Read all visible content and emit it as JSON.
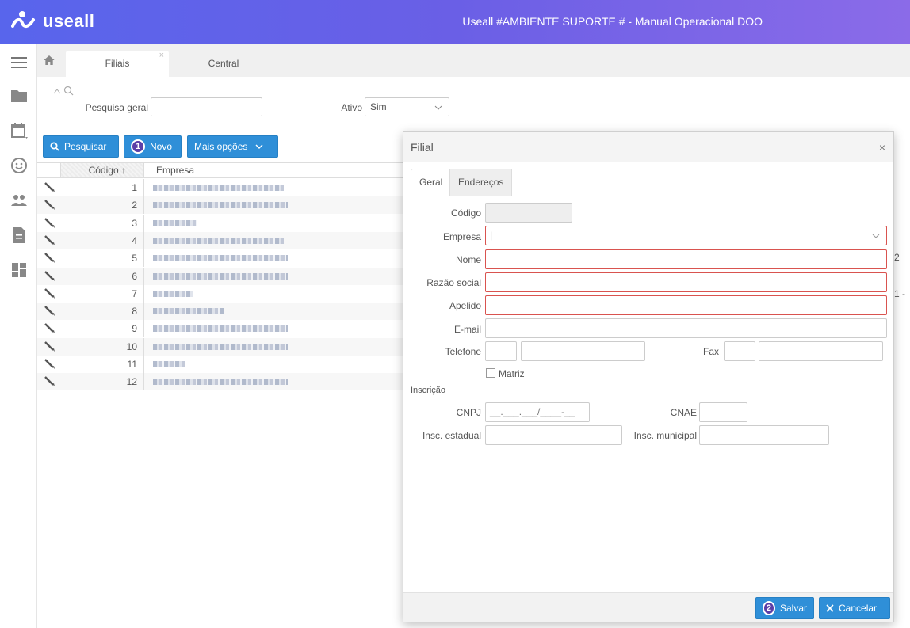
{
  "header": {
    "logo_text": "useall",
    "title": "Useall #AMBIENTE SUPORTE # - Manual Operacional DOO"
  },
  "sidebar": {
    "items": [
      "menu-icon",
      "folder-icon",
      "calendar-icon",
      "face-icon",
      "people-icon",
      "document-icon",
      "dashboard-icon"
    ]
  },
  "tabs": [
    {
      "label": "Filiais",
      "close": "×"
    },
    {
      "label": "Central"
    }
  ],
  "search": {
    "toggle": "^",
    "general_label": "Pesquisa geral",
    "general_value": "",
    "active_label": "Ativo",
    "active_value": "Sim"
  },
  "toolbar": {
    "search_label": "Pesquisar",
    "new_badge": "1",
    "new_label": "Novo",
    "more_label": "Mais opções"
  },
  "grid": {
    "col_code": "Código ↑",
    "col_company": "Empresa",
    "rows": [
      {
        "code": "1"
      },
      {
        "code": "2"
      },
      {
        "code": "3"
      },
      {
        "code": "4"
      },
      {
        "code": "5"
      },
      {
        "code": "6"
      },
      {
        "code": "7"
      },
      {
        "code": "8"
      },
      {
        "code": "9"
      },
      {
        "code": "10"
      },
      {
        "code": "11"
      },
      {
        "code": "12"
      }
    ]
  },
  "peek": {
    "row5": "2",
    "row7": "1 -"
  },
  "modal": {
    "title": "Filial",
    "close": "×",
    "tabs": {
      "general": "Geral",
      "addresses": "Endereços"
    },
    "fields": {
      "code": "Código",
      "company": "Empresa",
      "name": "Nome",
      "corporate_name": "Razão social",
      "nickname": "Apelido",
      "email": "E-mail",
      "phone": "Telefone",
      "fax": "Fax",
      "headquarters": "Matriz",
      "registration": "Inscrição",
      "cnpj": "CNPJ",
      "cnpj_mask": "__.___.___/____-__",
      "cnae": "CNAE",
      "state_reg": "Insc. estadual",
      "city_reg": "Insc. municipal"
    },
    "footer": {
      "save_badge": "2",
      "save_label": "Salvar",
      "cancel_label": "Cancelar"
    }
  },
  "colors": {
    "header_start": "#5865ec",
    "header_end": "#8b6be8",
    "primary_button": "#2f8fd8",
    "required_border": "#d9534f",
    "badge": "#5b3fa8"
  }
}
